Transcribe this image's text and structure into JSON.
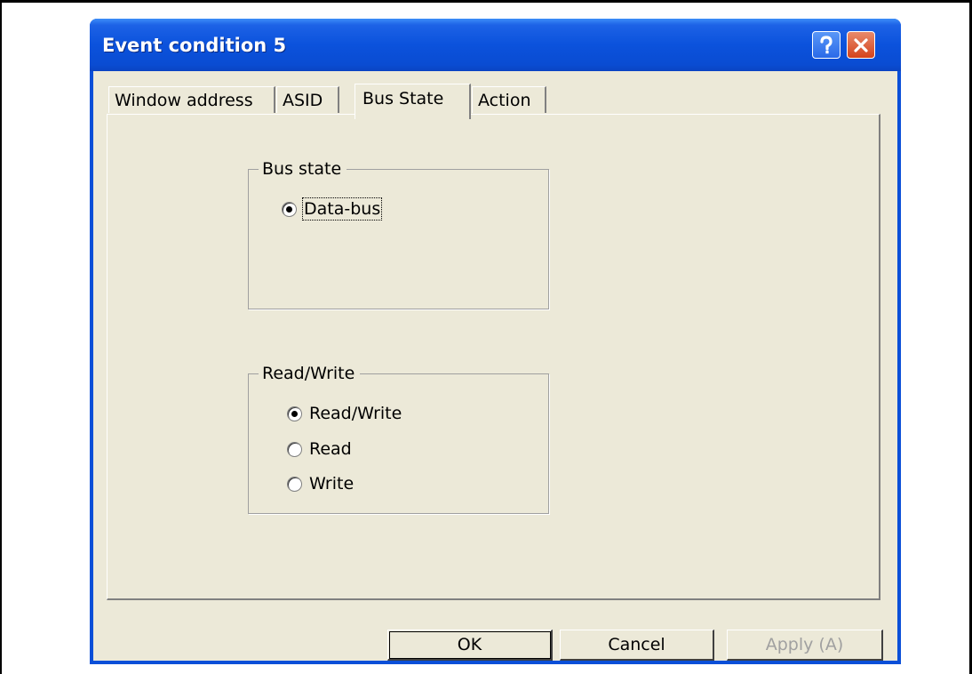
{
  "window": {
    "title": "Event condition 5"
  },
  "tabs": [
    {
      "label": "Window address",
      "active": false
    },
    {
      "label": "ASID",
      "active": false
    },
    {
      "label": "Bus State",
      "active": true
    },
    {
      "label": "Action",
      "active": false
    }
  ],
  "bus_state_group": {
    "legend": "Bus state",
    "options": [
      {
        "label": "Data-bus",
        "selected": true
      }
    ]
  },
  "read_write_group": {
    "legend": "Read/Write",
    "options": [
      {
        "label": "Read/Write",
        "selected": true
      },
      {
        "label": "Read",
        "selected": false
      },
      {
        "label": "Write",
        "selected": false
      }
    ]
  },
  "buttons": {
    "ok": "OK",
    "cancel": "Cancel",
    "apply": "Apply (A)"
  },
  "colors": {
    "titlebar": "#0a4fd8",
    "dialog_bg": "#ece9d8",
    "close_button": "#d4431c"
  }
}
